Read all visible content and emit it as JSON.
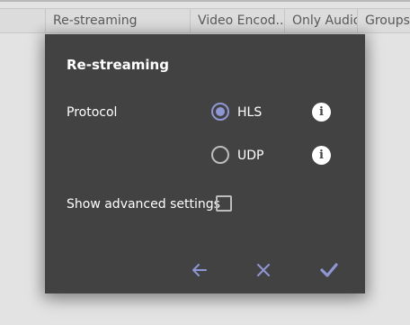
{
  "table": {
    "columns": [
      "Re-streaming",
      "Video Encod...",
      "Only Audio",
      "Groups"
    ]
  },
  "dialog": {
    "title": "Re-streaming",
    "protocol_label": "Protocol",
    "options": [
      {
        "label": "HLS",
        "selected": true
      },
      {
        "label": "UDP",
        "selected": false
      }
    ],
    "advanced_label": "Show advanced settings",
    "advanced_checked": false
  },
  "colors": {
    "dialog_bg": "#424242",
    "accent": "#8f96d6",
    "backdrop": "#e3e3e3"
  }
}
